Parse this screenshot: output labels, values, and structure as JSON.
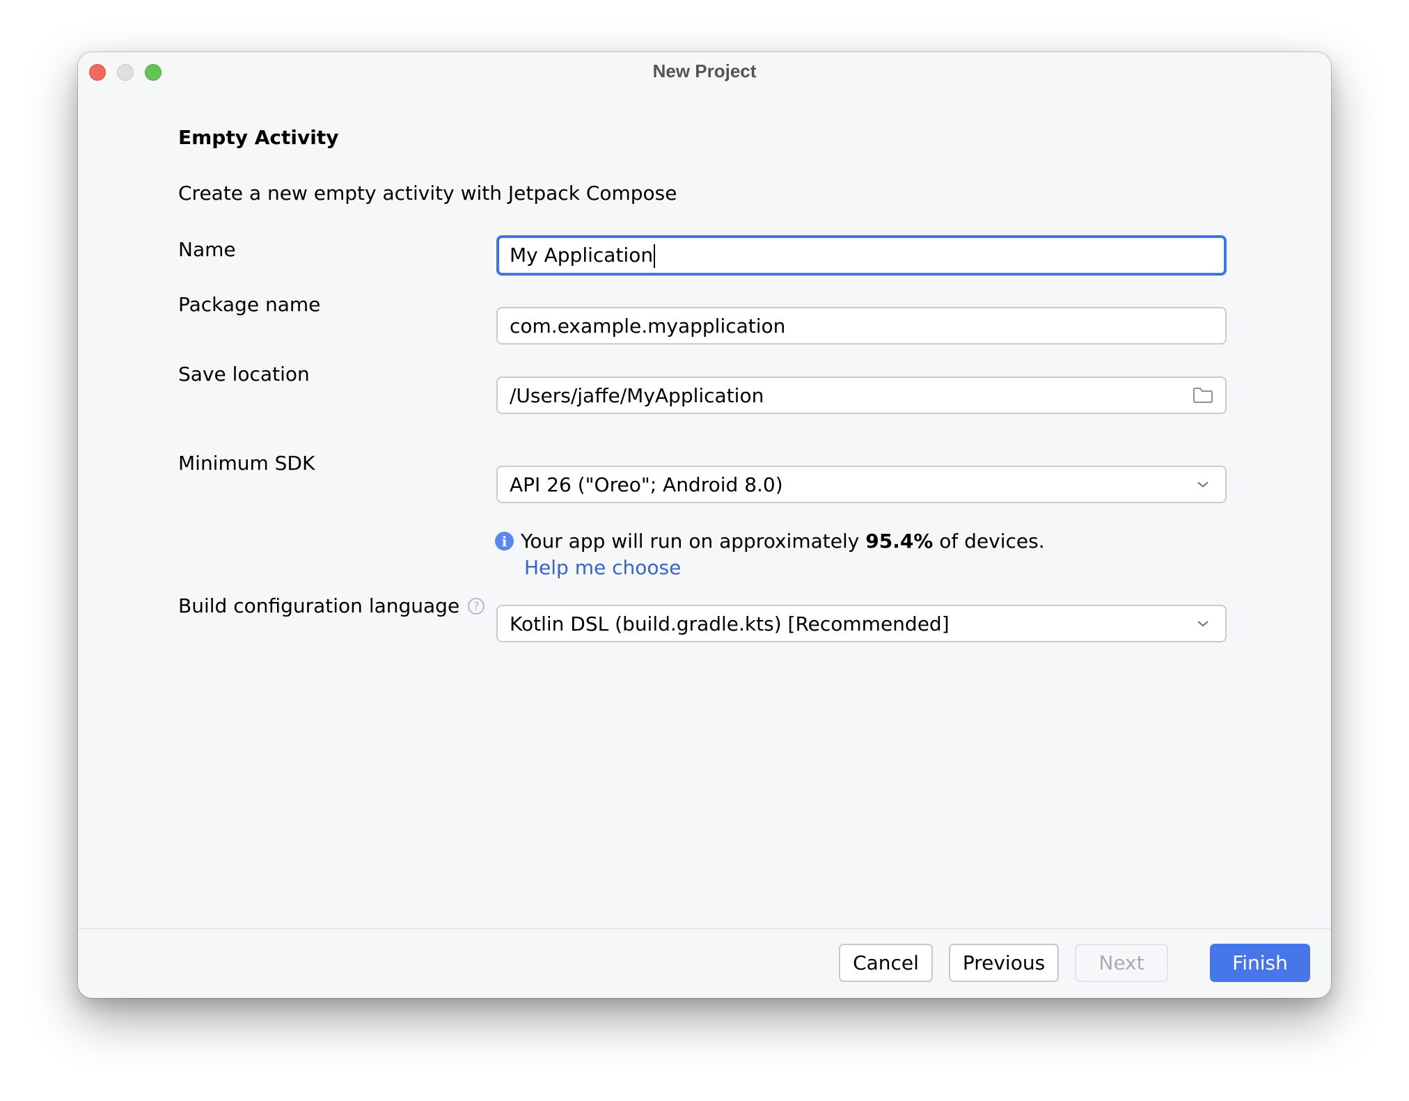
{
  "window": {
    "title": "New Project",
    "controls": [
      "close",
      "minimize",
      "maximize"
    ]
  },
  "header": {
    "title": "Empty Activity",
    "description": "Create a new empty activity with Jetpack Compose"
  },
  "form": {
    "name": {
      "label": "Name",
      "value": "My Application",
      "focused": true
    },
    "package_name": {
      "label": "Package name",
      "value": "com.example.myapplication"
    },
    "save_location": {
      "label": "Save location",
      "value": "/Users/jaffe/MyApplication",
      "icon": "folder-icon"
    },
    "minimum_sdk": {
      "label": "Minimum SDK",
      "value": "API 26 (\"Oreo\"; Android 8.0)",
      "icon": "chevron-down-icon"
    },
    "sdk_info": {
      "icon": "info-icon",
      "prefix": "Your app will run on approximately ",
      "percent": "95.4%",
      "suffix": " of devices.",
      "link": "Help me choose"
    },
    "build_config_language": {
      "label": "Build configuration language",
      "help_icon": "question-icon",
      "value": "Kotlin DSL (build.gradle.kts) [Recommended]",
      "icon": "chevron-down-icon"
    }
  },
  "footer": {
    "cancel": "Cancel",
    "previous": "Previous",
    "next": "Next",
    "finish": "Finish"
  },
  "colors": {
    "accent": "#4676e8",
    "focus_border": "#3d74e6",
    "link": "#3862c6",
    "info": "#5a87ea",
    "window_bg": "#f6f7f9"
  }
}
